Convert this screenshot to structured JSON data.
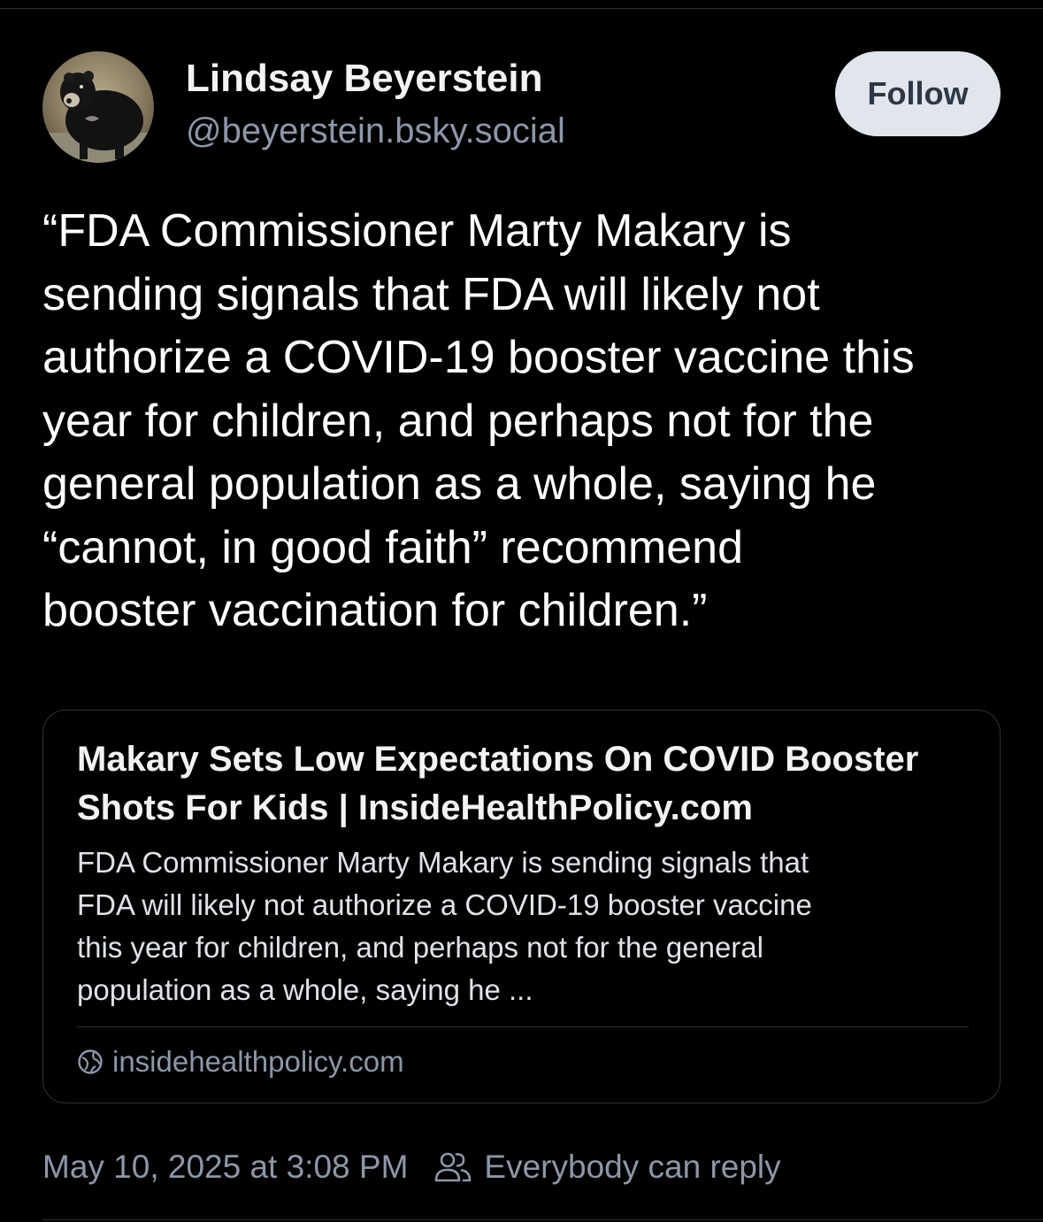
{
  "author": {
    "display_name": "Lindsay Beyerstein",
    "handle": "@beyerstein.bsky.social",
    "avatar_icon": "sloth-bear-avatar"
  },
  "follow_button": {
    "label": "Follow"
  },
  "post": {
    "text_lines": [
      "“FDA Commissioner Marty Makary is",
      "sending signals that FDA will likely not",
      "authorize a COVID-19 booster vaccine this",
      "year for children, and perhaps not for the",
      "general population as a whole, saying he",
      "“cannot, in good faith” recommend",
      "booster vaccination for children.”"
    ]
  },
  "link_card": {
    "title_lines": [
      "Makary Sets Low Expectations On COVID Booster",
      "Shots For Kids | InsideHealthPolicy.com"
    ],
    "description_lines": [
      "FDA Commissioner Marty Makary is sending signals that",
      "FDA will likely not authorize a COVID-19 booster vaccine",
      "this year for children, and perhaps not for the general",
      "population as a whole, saying he ..."
    ],
    "domain": "insidehealthpolicy.com",
    "domain_icon": "globe-icon"
  },
  "footer": {
    "timestamp": "May 10, 2025 at 3:08 PM",
    "reply_setting": "Everybody can reply",
    "reply_icon": "people-icon"
  },
  "colors": {
    "background": "#000000",
    "text_primary": "#ffffff",
    "text_secondary": "#8c97a8",
    "follow_button_bg": "#e1e5ec",
    "follow_button_text": "#2d3846",
    "card_border": "#2c323c"
  }
}
